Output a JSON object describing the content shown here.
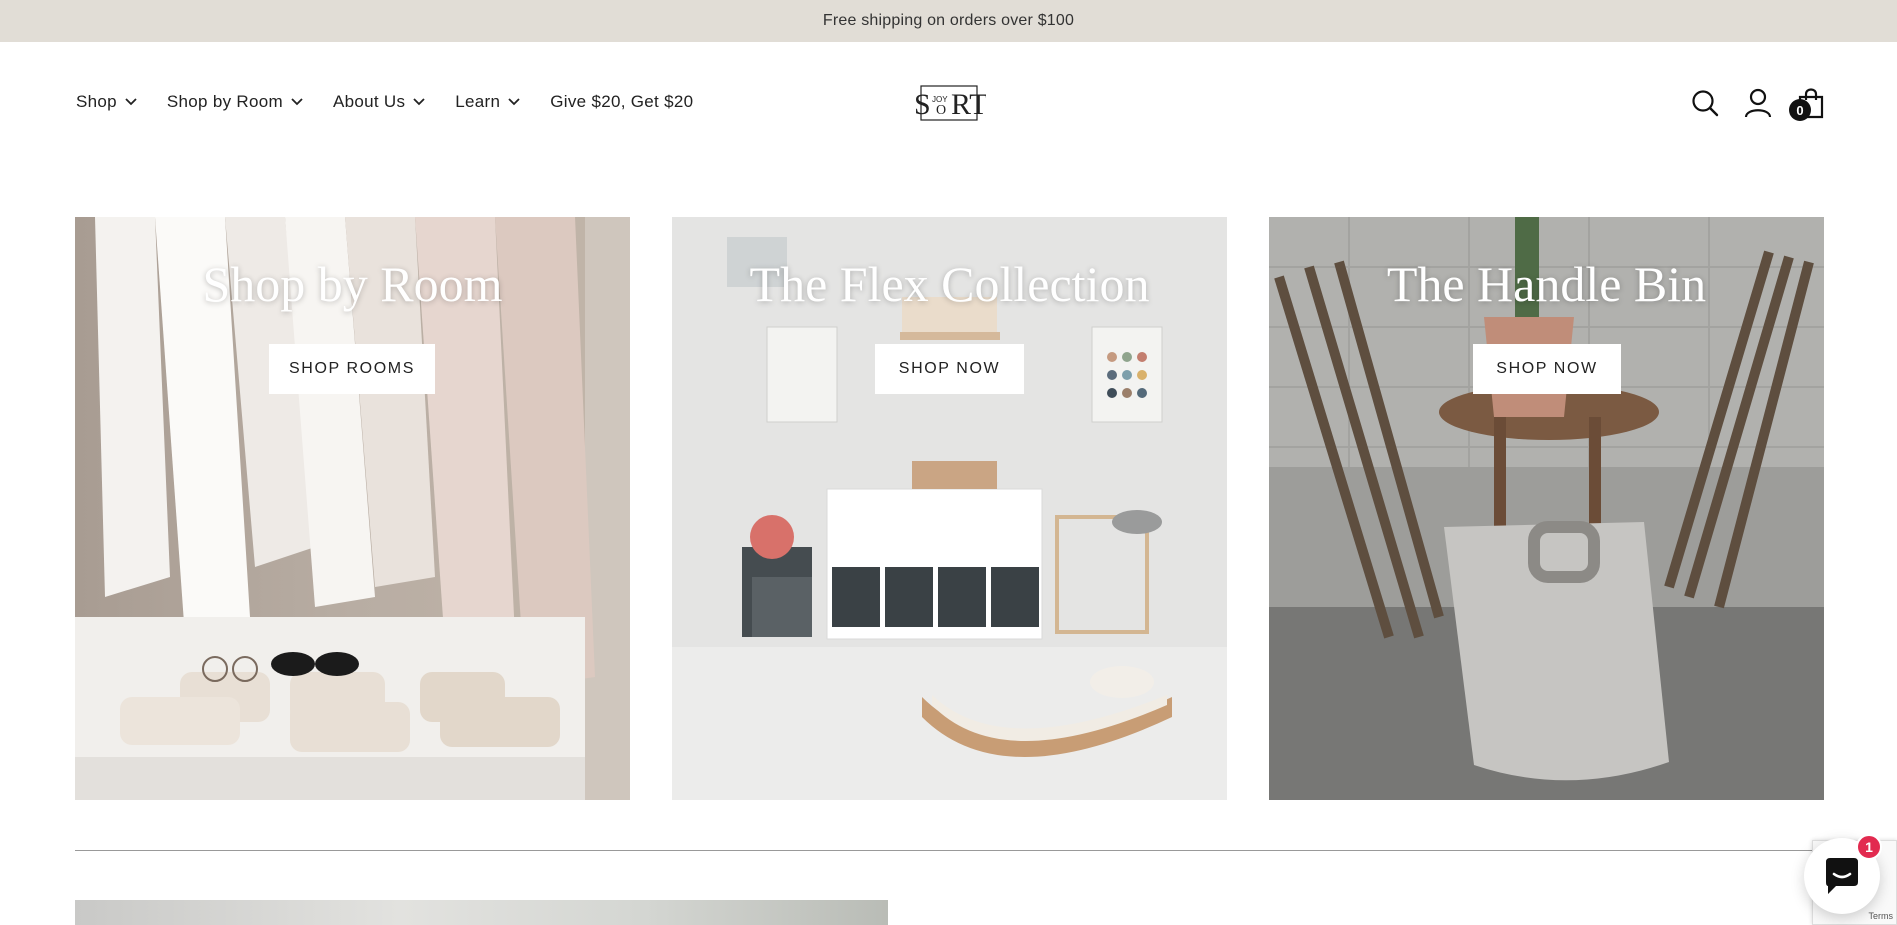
{
  "announcement": {
    "text": "Free shipping on orders over $100"
  },
  "nav": {
    "items": [
      {
        "label": "Shop",
        "has_dropdown": true
      },
      {
        "label": "Shop by Room",
        "has_dropdown": true
      },
      {
        "label": "About Us",
        "has_dropdown": true
      },
      {
        "label": "Learn",
        "has_dropdown": true
      },
      {
        "label": "Give $20, Get $20",
        "has_dropdown": false
      }
    ]
  },
  "logo": {
    "text": "SORT",
    "small_text": "JOY"
  },
  "header_icons": {
    "search": "search-icon",
    "account": "account-icon",
    "cart": "cart-icon",
    "cart_count": "0"
  },
  "tiles": [
    {
      "title": "Shop by Room",
      "button": "SHOP ROOMS"
    },
    {
      "title": "The Flex Collection",
      "button": "SHOP NOW"
    },
    {
      "title": "The Handle Bin",
      "button": "SHOP NOW"
    }
  ],
  "chat": {
    "badge": "1",
    "icon": "chat-icon"
  },
  "recaptcha": {
    "terms": "Terms"
  },
  "colors": {
    "announcement_bg": "#e1ddd6",
    "text": "#222222",
    "chat_badge": "#e22a4f"
  }
}
